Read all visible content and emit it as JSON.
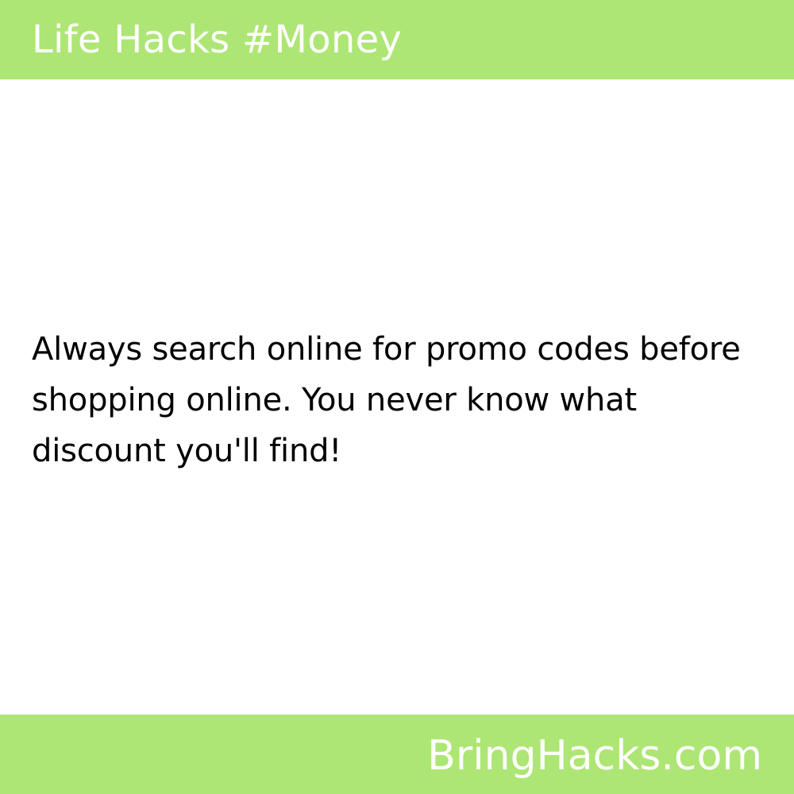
{
  "header": {
    "title": "Life Hacks #Money"
  },
  "tip": {
    "text": "Always search online for promo codes before shopping online. You never know what discount you'll find!"
  },
  "footer": {
    "site": "BringHacks.com"
  },
  "colors": {
    "band": "#ade674",
    "band_text": "#ffffff",
    "body_text": "#000000",
    "background": "#ffffff"
  }
}
